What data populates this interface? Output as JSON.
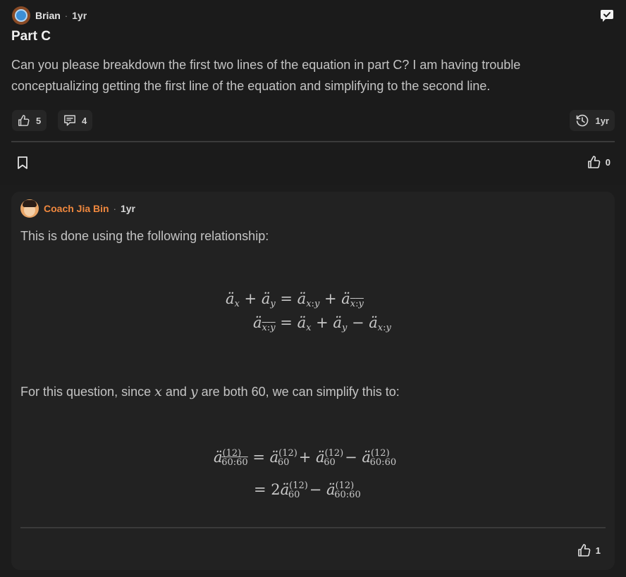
{
  "post": {
    "author": "Brian",
    "separator": "·",
    "time": "1yr",
    "title": "Part C",
    "body": "Can you please breakdown the first two lines of the equation in part C? I am having trouble conceptualizing getting the first line of the equation and simplifying to the second line.",
    "likes": "5",
    "comments": "4",
    "history_time": "1yr",
    "votes": "0"
  },
  "reply": {
    "author": "Coach Jia Bin",
    "separator": "·",
    "time": "1yr",
    "intro": "This is done using the following relationship:",
    "equations_1": [
      "ä_x + ä_y = ä_{x:y} + ä_{\\overline{x:y}}",
      "ä_{\\overline{x:y}} = ä_x + ä_y − ä_{x:y}"
    ],
    "followup_before": "For this question, since ",
    "var_x": "x",
    "followup_and": " and ",
    "var_y": "y",
    "followup_after": " are both 60, we can simplify this to:",
    "equations_2": [
      "ä^{(12)}_{\\overline{60:60}} = ä^{(12)}_{60} + ä^{(12)}_{60} − ä^{(12)}_{60:60}",
      "= 2ä^{(12)}_{60} − ä^{(12)}_{60:60}"
    ],
    "votes": "1"
  },
  "icons": {
    "flag": "flag-chat-icon",
    "like": "thumbs-up-icon",
    "comment": "comment-icon",
    "history": "history-clock-icon",
    "bookmark": "bookmark-icon"
  },
  "colors": {
    "background": "#1c1c1c",
    "reply_card": "#222222",
    "coach_name": "#f0883e",
    "pill": "#262626"
  }
}
